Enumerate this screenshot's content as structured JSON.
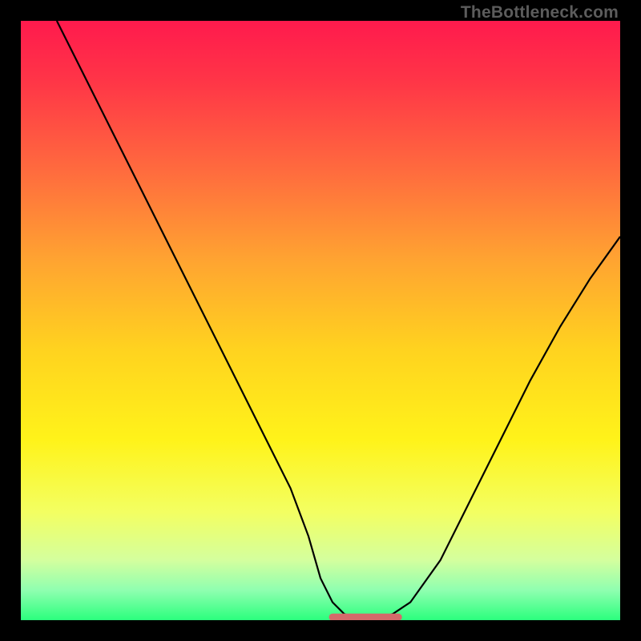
{
  "watermark": "TheBottleneck.com",
  "colors": {
    "frame": "#000000",
    "gradient_stops": [
      {
        "offset": 0.0,
        "color": "#ff1a4d"
      },
      {
        "offset": 0.1,
        "color": "#ff3547"
      },
      {
        "offset": 0.25,
        "color": "#ff6b3e"
      },
      {
        "offset": 0.4,
        "color": "#ffa431"
      },
      {
        "offset": 0.55,
        "color": "#ffd31f"
      },
      {
        "offset": 0.7,
        "color": "#fff31a"
      },
      {
        "offset": 0.82,
        "color": "#f3ff62"
      },
      {
        "offset": 0.9,
        "color": "#d4ff9e"
      },
      {
        "offset": 0.95,
        "color": "#8fffb0"
      },
      {
        "offset": 1.0,
        "color": "#2bff7d"
      }
    ],
    "curve": "#000000",
    "bottom_marker": "#d46a6a"
  },
  "chart_data": {
    "type": "line",
    "title": "",
    "xlabel": "",
    "ylabel": "",
    "xlim": [
      0,
      100
    ],
    "ylim": [
      0,
      100
    ],
    "grid": false,
    "legend": false,
    "series": [
      {
        "name": "bottleneck-curve",
        "x": [
          6,
          10,
          15,
          20,
          25,
          30,
          35,
          40,
          45,
          48,
          50,
          52,
          54,
          56,
          58,
          60,
          62,
          65,
          70,
          75,
          80,
          85,
          90,
          95,
          100
        ],
        "y": [
          100,
          92,
          82,
          72,
          62,
          52,
          42,
          32,
          22,
          14,
          7,
          3,
          1,
          0.5,
          0.5,
          0.5,
          1,
          3,
          10,
          20,
          30,
          40,
          49,
          57,
          64
        ]
      }
    ],
    "annotations": [
      {
        "name": "flat-bottom-marker",
        "x_range": [
          52,
          63
        ],
        "y": 0.5,
        "note": "short flat red/pink segment at curve minimum"
      }
    ]
  }
}
